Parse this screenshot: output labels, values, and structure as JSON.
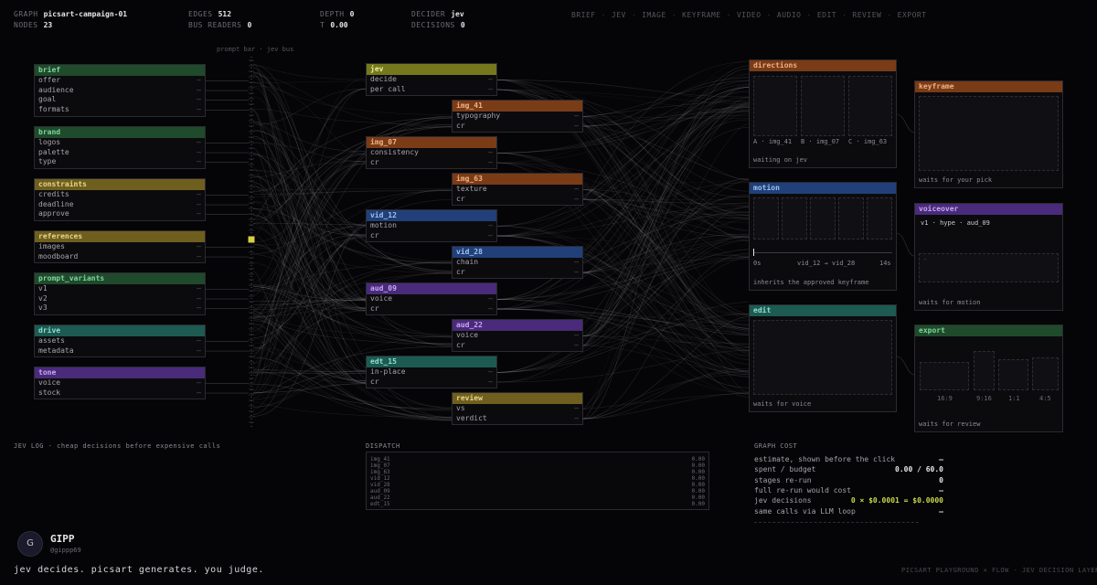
{
  "header": {
    "graph_label": "GRAPH",
    "graph_value": "picsart-campaign-01",
    "nodes_label": "NODES",
    "nodes_value": "23",
    "edges_label": "EDGES",
    "edges_value": "512",
    "bus_label": "BUS READERS",
    "bus_value": "0",
    "depth_label": "DEPTH",
    "depth_value": "0",
    "t_label": "T",
    "t_value": "0.00",
    "decider_label": "DECIDER",
    "decider_value": "jev",
    "decisions_label": "DECISIONS",
    "decisions_value": "0"
  },
  "nav": [
    "BRIEF",
    "JEV",
    "IMAGE",
    "KEYFRAME",
    "VIDEO",
    "AUDIO",
    "EDIT",
    "REVIEW",
    "EXPORT"
  ],
  "nav_sep": "·",
  "bus_caption": "prompt bar · jev bus",
  "left_nodes": [
    {
      "title": "brief",
      "color": "green",
      "rows": [
        "offer",
        "audience",
        "goal",
        "formats"
      ]
    },
    {
      "title": "brand",
      "color": "green",
      "rows": [
        "logos",
        "palette",
        "type"
      ]
    },
    {
      "title": "constraints",
      "color": "yellow",
      "rows": [
        "credits",
        "deadline",
        "approve"
      ]
    },
    {
      "title": "references",
      "color": "yellow",
      "rows": [
        "images",
        "moodboard"
      ]
    },
    {
      "title": "prompt_variants",
      "color": "green",
      "rows": [
        "v1",
        "v2",
        "v3"
      ]
    },
    {
      "title": "drive",
      "color": "teal",
      "rows": [
        "assets",
        "metadata"
      ]
    },
    {
      "title": "tone",
      "color": "purple",
      "rows": [
        "voice",
        "stock"
      ]
    }
  ],
  "mid_nodes": [
    {
      "title": "jev",
      "color": "ltolive",
      "rows": [
        "decide",
        "per call"
      ]
    },
    {
      "title": "img_41",
      "color": "orange",
      "rows": [
        "typography",
        "cr"
      ]
    },
    {
      "title": "img_07",
      "color": "orange",
      "rows": [
        "consistency",
        "cr"
      ]
    },
    {
      "title": "img_63",
      "color": "orange",
      "rows": [
        "texture",
        "cr"
      ]
    },
    {
      "title": "vid_12",
      "color": "blue",
      "rows": [
        "motion",
        "cr"
      ]
    },
    {
      "title": "vid_28",
      "color": "blue",
      "rows": [
        "chain",
        "cr"
      ]
    },
    {
      "title": "aud_09",
      "color": "purple",
      "rows": [
        "voice",
        "cr"
      ]
    },
    {
      "title": "aud_22",
      "color": "purple",
      "rows": [
        "voice",
        "cr"
      ]
    },
    {
      "title": "edt_15",
      "color": "teal",
      "rows": [
        "in-place",
        "cr"
      ]
    },
    {
      "title": "review",
      "color": "yellow",
      "rows": [
        "vs",
        "verdict"
      ]
    }
  ],
  "row_dash": "—",
  "panels": {
    "directions": {
      "title": "directions",
      "labels": [
        "A · img_41",
        "B · img_07",
        "C · img_63"
      ],
      "foot": "waiting on jev"
    },
    "motion": {
      "title": "motion",
      "scale_start": "0s",
      "scale_mid": "vid_12 → vid_28",
      "scale_end": "14s",
      "foot": "inherits the approved keyframe"
    },
    "edit": {
      "title": "edit",
      "foot": "waits for voice"
    },
    "keyframe": {
      "title": "keyframe",
      "foot": "waits for your pick"
    },
    "voiceover": {
      "title": "voiceover",
      "line": "v1 · hype · aud_09",
      "inner": "-",
      "foot": "waits for motion"
    },
    "export": {
      "title": "export",
      "ratios": [
        "16:9",
        "9:16",
        "1:1",
        "4:5"
      ],
      "foot": "waits for review"
    }
  },
  "jev_log": "JEV LOG · cheap decisions before expensive calls",
  "dispatch": {
    "title": "DISPATCH",
    "rows": [
      {
        "name": "img_41",
        "value": "0.00"
      },
      {
        "name": "img_07",
        "value": "0.00"
      },
      {
        "name": "img_63",
        "value": "0.00"
      },
      {
        "name": "vid_12",
        "value": "0.00"
      },
      {
        "name": "vid_28",
        "value": "0.00"
      },
      {
        "name": "aud_09",
        "value": "0.00"
      },
      {
        "name": "aud_22",
        "value": "0.00"
      },
      {
        "name": "edt_15",
        "value": "0.00"
      }
    ]
  },
  "graph_cost": {
    "title": "GRAPH COST",
    "rows": [
      {
        "label": "estimate, shown before the click",
        "value": "—"
      },
      {
        "label": "spent / budget",
        "value": "0.00 / 60.0"
      },
      {
        "label": "stages re-run",
        "value": "0"
      },
      {
        "label": "full re-run would cost",
        "value": "—"
      },
      {
        "label": "jev decisions",
        "value": "0 × $0.0001 = $0.0000"
      },
      {
        "label": "same calls via LLM loop",
        "value": "—"
      }
    ]
  },
  "author": {
    "avatar_letter": "G",
    "name": "GIPP",
    "handle": "@gippp69"
  },
  "tagline": "jev decides. picsart generates. you judge.",
  "footer": "PICSART PLAYGROUND × FLOW · JEV DECISION LAYER",
  "colors": {
    "background": "#050507",
    "green": "#1f4a2c",
    "yellow": "#6f5f1e",
    "orange": "#7a3b17",
    "blue": "#21407a",
    "purple": "#4a2a7a",
    "teal": "#1d5a52",
    "olive": "#76781d"
  }
}
